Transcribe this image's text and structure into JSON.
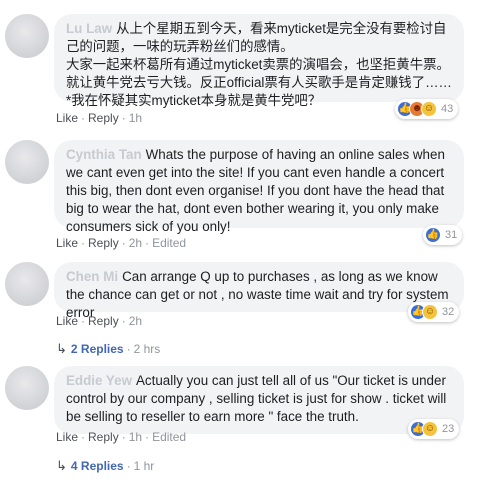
{
  "comments": [
    {
      "name": "Lu Law",
      "text": "从上个星期五到今天，看来myticket是完全没有要检讨自己的问题，一味的玩弄粉丝们的感情。\n大家一起来杯葛所有通过myticket卖票的演唱会，也坚拒黄牛票。就让黄牛党去亏大钱。反正official票有人买歌手是肯定赚钱了……\n*我在怀疑其实myticket本身就是黄牛党吧？",
      "like_label": "Like",
      "reply_label": "Reply",
      "time": "1h",
      "edited": "",
      "reaction_icons": [
        "like-icon",
        "angry-icon",
        "haha-icon"
      ],
      "reaction_count": "43"
    },
    {
      "name": "Cynthia Tan",
      "text": "Whats the purpose of having an online sales when we cant even get into the site! If you cant even handle a concert this big, then dont even organise! If you dont have the head that big to wear the hat, dont even bother wearing it, you only make consumers sick of you only!",
      "like_label": "Like",
      "reply_label": "Reply",
      "time": "2h",
      "edited": "Edited",
      "reaction_icons": [
        "like-icon"
      ],
      "reaction_count": "31"
    },
    {
      "name": "Chen Mi",
      "text": "Can arrange Q up to purchases , as long as we know the chance can get or not , no waste time wait and try for system error",
      "like_label": "Like",
      "reply_label": "Reply",
      "time": "2h",
      "edited": "",
      "reaction_icons": [
        "like-icon",
        "haha-icon"
      ],
      "reaction_count": "32",
      "replies_label": "2 Replies",
      "replies_time": "2 hrs"
    },
    {
      "name": "Eddie Yew",
      "text": "Actually you can just tell all of us \"Our ticket is under control by our company , selling ticket is just for show . ticket will be selling to reseller to earn more \" face the truth.",
      "like_label": "Like",
      "reply_label": "Reply",
      "time": "1h",
      "edited": "Edited",
      "reaction_icons": [
        "like-icon",
        "haha-icon"
      ],
      "reaction_count": "23",
      "replies_label": "4 Replies",
      "replies_time": "1 hr"
    }
  ],
  "top_partial_text": "95 Replies",
  "colors": {
    "bubble_bg": "#f2f3f5",
    "link": "#4267b2",
    "meta": "#90949c",
    "like_blue": "#3b6fd8",
    "haha_yellow": "#f5c33b"
  }
}
